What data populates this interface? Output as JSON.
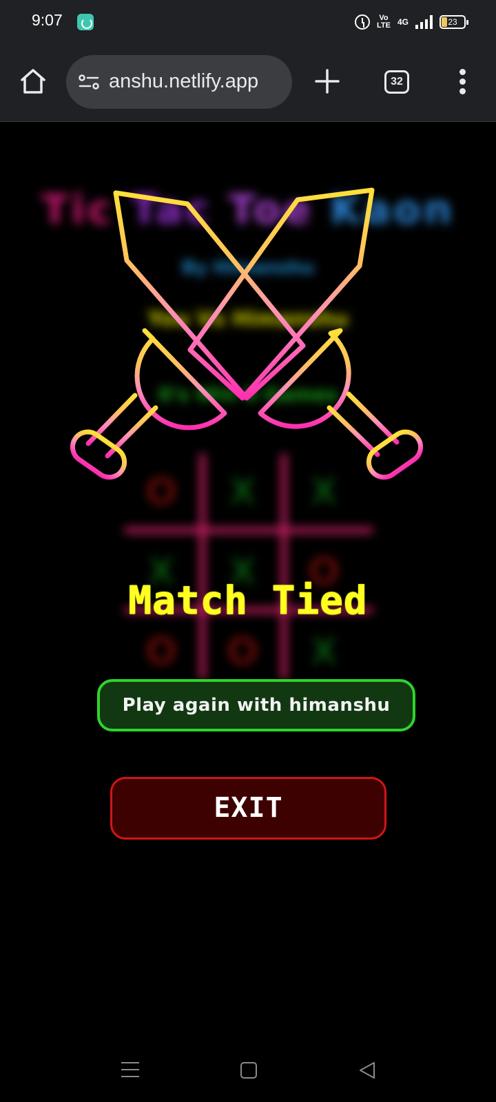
{
  "status_bar": {
    "time": "9:07",
    "volte_top": "Vo",
    "volte_bottom": "LTE",
    "network": "4G",
    "battery": "23",
    "icons": [
      "app-notification-icon",
      "alarm-icon",
      "signal-icon",
      "battery-icon"
    ]
  },
  "browser": {
    "url": "anshu.netlify.app",
    "tab_count": "32",
    "icons": [
      "home-icon",
      "site-settings-icon",
      "plus-icon",
      "more-vert-icon"
    ]
  },
  "game": {
    "title_parts": [
      "Tic",
      "Tac",
      "Toe",
      "Kaon"
    ],
    "subtitle": "By Himanshu",
    "matchup": "You Vs Himanshu",
    "score": "0's Win 0 Games",
    "board": [
      [
        "O",
        "X",
        "X"
      ],
      [
        "X",
        "X",
        "O"
      ],
      [
        "O",
        "O",
        "X"
      ]
    ],
    "result": "Match Tied",
    "play_again_label": "Play again with himanshu",
    "exit_label": "EXIT"
  },
  "colors": {
    "accent_yellow": "#ffff20",
    "accent_green": "#2ed42e",
    "accent_red": "#d31515",
    "sword_pink": "#ff4fb0",
    "sword_gold": "#ffd93a"
  },
  "nav_bar": {
    "icons": [
      "recents-icon",
      "home-square-icon",
      "back-triangle-icon"
    ]
  }
}
